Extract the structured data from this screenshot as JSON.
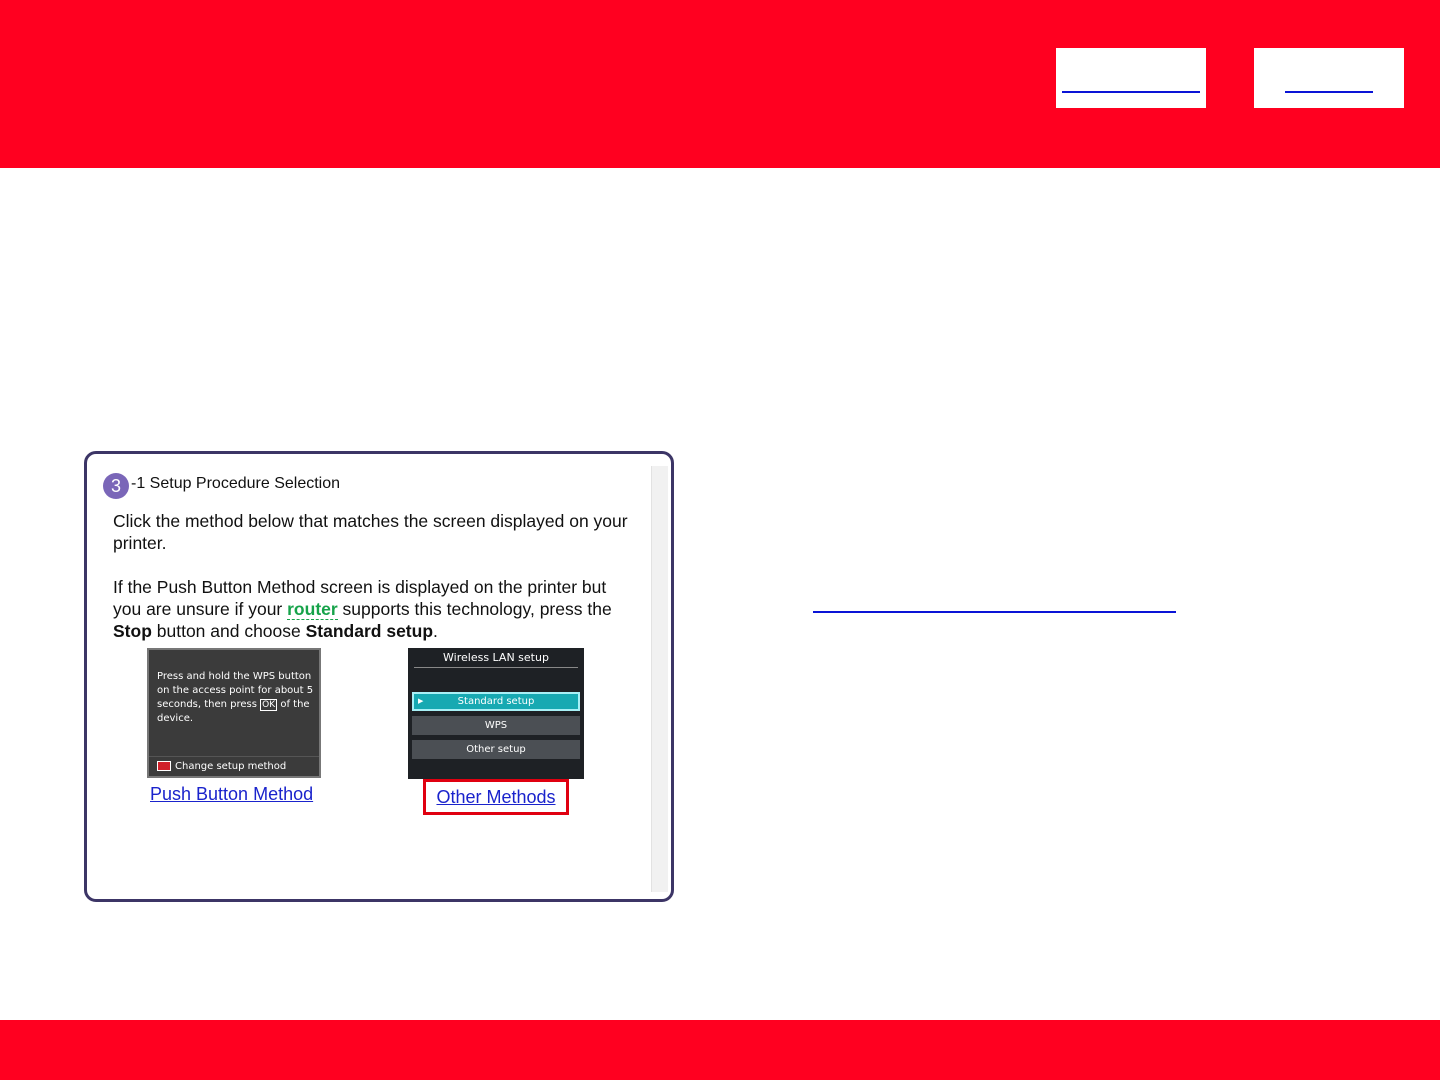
{
  "panel": {
    "step_number": "3",
    "title": "-1 Setup Procedure Selection",
    "para1": "Click the method below that matches the screen displayed on your printer.",
    "para2": {
      "before": "If the Push Button Method screen is displayed on the printer but you are unsure if your ",
      "term": "router",
      "middle": " supports this technology, press the ",
      "stop": "Stop",
      "middle2": " button and choose ",
      "standard": "Standard setup",
      "end": "."
    },
    "screen1": {
      "message_a": "Press and hold the WPS button on the access point for about 5 seconds, then press ",
      "ok_label": "OK",
      "message_b": " of the device.",
      "footer": "Change setup method"
    },
    "screen2": {
      "title": "Wireless LAN setup",
      "options": [
        "Standard setup",
        "WPS",
        "Other setup"
      ],
      "selected": "Standard setup"
    },
    "links": {
      "push_button": "Push Button Method",
      "other_methods": "Other Methods"
    }
  },
  "colors": {
    "brand_red": "#ff0020",
    "link_blue": "#1a23cc",
    "highlight_red": "#e00010",
    "term_green": "#16a34a",
    "badge_purple": "#7a66b8"
  }
}
